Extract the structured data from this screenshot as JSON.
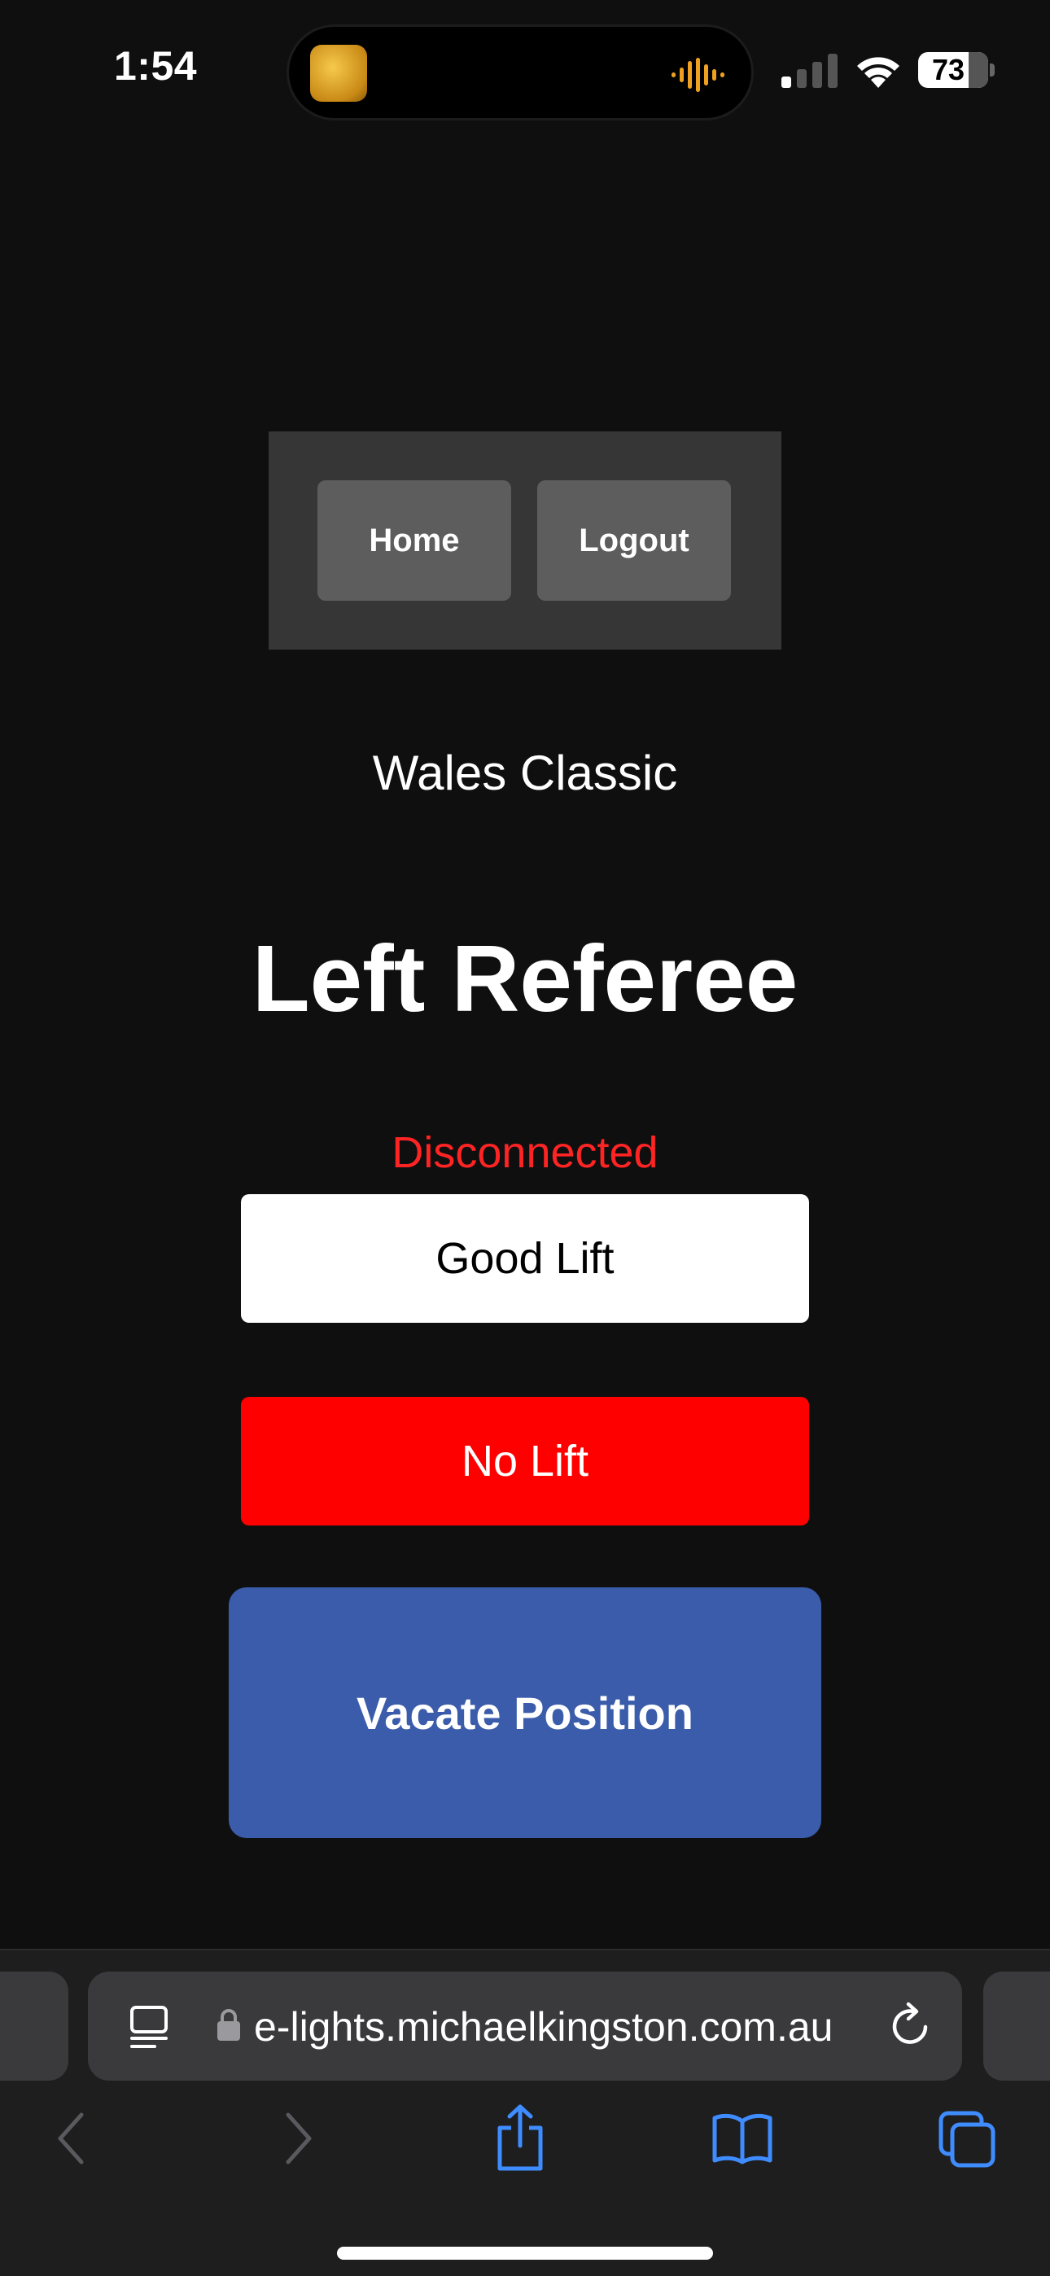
{
  "status_bar": {
    "time": "1:54",
    "battery": "73",
    "accent_color": "#f0a020"
  },
  "nav": {
    "home_label": "Home",
    "logout_label": "Logout"
  },
  "main": {
    "meet_name": "Wales Classic",
    "role_title": "Left Referee",
    "connection_status": "Disconnected",
    "good_lift_label": "Good Lift",
    "no_lift_label": "No Lift",
    "vacate_label": "Vacate Position"
  },
  "browser": {
    "url": "e-lights.michaelkingston.com.au"
  },
  "colors": {
    "background": "#0f0f10",
    "nav_box": "#363637",
    "nav_button": "#5d5d5d",
    "disconnected": "#ff2424",
    "no_lift": "#ff0000",
    "vacate": "#3a5caa",
    "browser_accent": "#3f8cff"
  },
  "icons": {
    "reader": "reader-mode-icon",
    "lock": "lock-icon",
    "reload": "reload-icon",
    "back": "chevron-left-icon",
    "forward": "chevron-right-icon",
    "share": "share-icon",
    "bookmarks": "book-icon",
    "tabs": "tabs-icon"
  }
}
